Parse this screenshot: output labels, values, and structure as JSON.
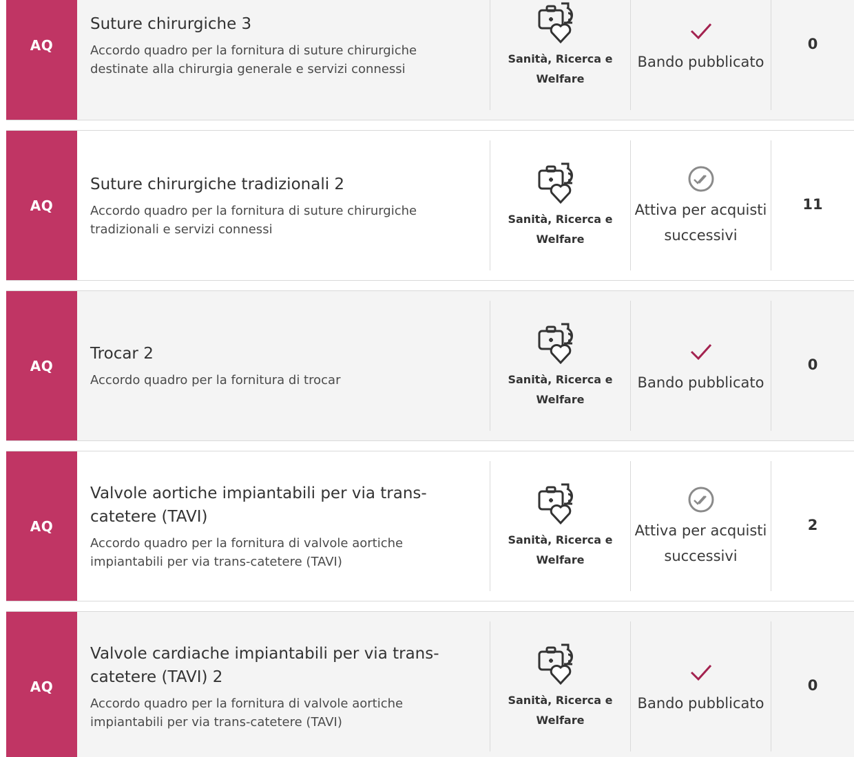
{
  "rows": [
    {
      "type": "AQ",
      "title": "Suture chirurgiche 3",
      "description": "Accordo quadro per la fornitura di suture chirurgiche destinate alla chirurgia generale e servizi connessi",
      "area_icon": "health-research-welfare-icon",
      "area": "Sanità, Ricerca e Welfare",
      "status_icon": "check-icon",
      "status": "Bando pubblicato",
      "count": "0"
    },
    {
      "type": "AQ",
      "title": "Suture chirurgiche tradizionali 2",
      "description": "Accordo quadro per la fornitura di suture chirurgiche tradizionali e servizi connessi",
      "area_icon": "health-research-welfare-icon",
      "area": "Sanità, Ricerca e Welfare",
      "status_icon": "double-check-circle-icon",
      "status": "Attiva per acquisti successivi",
      "count": "11"
    },
    {
      "type": "AQ",
      "title": "Trocar 2",
      "description": "Accordo quadro per la fornitura di trocar",
      "area_icon": "health-research-welfare-icon",
      "area": "Sanità, Ricerca e Welfare",
      "status_icon": "check-icon",
      "status": "Bando pubblicato",
      "count": "0"
    },
    {
      "type": "AQ",
      "title": "Valvole aortiche impiantabili per via trans-catetere (TAVI)",
      "description": "Accordo quadro per la fornitura di valvole aortiche impiantabili per via trans-catetere (TAVI)",
      "area_icon": "health-research-welfare-icon",
      "area": "Sanità, Ricerca e Welfare",
      "status_icon": "double-check-circle-icon",
      "status": "Attiva per acquisti successivi",
      "count": "2"
    },
    {
      "type": "AQ",
      "title": "Valvole cardiache impiantabili per via trans-catetere (TAVI) 2",
      "description": "Accordo quadro per la fornitura di valvole aortiche impiantabili per via trans-catetere (TAVI)",
      "area_icon": "health-research-welfare-icon",
      "area": "Sanità, Ricerca e Welfare",
      "status_icon": "check-icon",
      "status": "Bando pubblicato",
      "count": "0"
    }
  ],
  "colors": {
    "type_tag_bg": "#c03564",
    "check": "#a3224f",
    "double_check": "#8a8a8a"
  }
}
